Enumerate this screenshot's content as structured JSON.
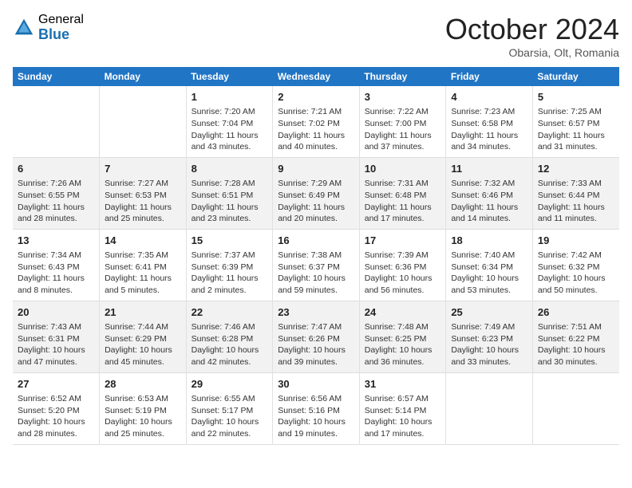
{
  "header": {
    "logo_general": "General",
    "logo_blue": "Blue",
    "month_title": "October 2024",
    "location": "Obarsia, Olt, Romania"
  },
  "days_of_week": [
    "Sunday",
    "Monday",
    "Tuesday",
    "Wednesday",
    "Thursday",
    "Friday",
    "Saturday"
  ],
  "weeks": [
    [
      {
        "day": "",
        "sunrise": "",
        "sunset": "",
        "daylight": ""
      },
      {
        "day": "",
        "sunrise": "",
        "sunset": "",
        "daylight": ""
      },
      {
        "day": "1",
        "sunrise": "Sunrise: 7:20 AM",
        "sunset": "Sunset: 7:04 PM",
        "daylight": "Daylight: 11 hours and 43 minutes."
      },
      {
        "day": "2",
        "sunrise": "Sunrise: 7:21 AM",
        "sunset": "Sunset: 7:02 PM",
        "daylight": "Daylight: 11 hours and 40 minutes."
      },
      {
        "day": "3",
        "sunrise": "Sunrise: 7:22 AM",
        "sunset": "Sunset: 7:00 PM",
        "daylight": "Daylight: 11 hours and 37 minutes."
      },
      {
        "day": "4",
        "sunrise": "Sunrise: 7:23 AM",
        "sunset": "Sunset: 6:58 PM",
        "daylight": "Daylight: 11 hours and 34 minutes."
      },
      {
        "day": "5",
        "sunrise": "Sunrise: 7:25 AM",
        "sunset": "Sunset: 6:57 PM",
        "daylight": "Daylight: 11 hours and 31 minutes."
      }
    ],
    [
      {
        "day": "6",
        "sunrise": "Sunrise: 7:26 AM",
        "sunset": "Sunset: 6:55 PM",
        "daylight": "Daylight: 11 hours and 28 minutes."
      },
      {
        "day": "7",
        "sunrise": "Sunrise: 7:27 AM",
        "sunset": "Sunset: 6:53 PM",
        "daylight": "Daylight: 11 hours and 25 minutes."
      },
      {
        "day": "8",
        "sunrise": "Sunrise: 7:28 AM",
        "sunset": "Sunset: 6:51 PM",
        "daylight": "Daylight: 11 hours and 23 minutes."
      },
      {
        "day": "9",
        "sunrise": "Sunrise: 7:29 AM",
        "sunset": "Sunset: 6:49 PM",
        "daylight": "Daylight: 11 hours and 20 minutes."
      },
      {
        "day": "10",
        "sunrise": "Sunrise: 7:31 AM",
        "sunset": "Sunset: 6:48 PM",
        "daylight": "Daylight: 11 hours and 17 minutes."
      },
      {
        "day": "11",
        "sunrise": "Sunrise: 7:32 AM",
        "sunset": "Sunset: 6:46 PM",
        "daylight": "Daylight: 11 hours and 14 minutes."
      },
      {
        "day": "12",
        "sunrise": "Sunrise: 7:33 AM",
        "sunset": "Sunset: 6:44 PM",
        "daylight": "Daylight: 11 hours and 11 minutes."
      }
    ],
    [
      {
        "day": "13",
        "sunrise": "Sunrise: 7:34 AM",
        "sunset": "Sunset: 6:43 PM",
        "daylight": "Daylight: 11 hours and 8 minutes."
      },
      {
        "day": "14",
        "sunrise": "Sunrise: 7:35 AM",
        "sunset": "Sunset: 6:41 PM",
        "daylight": "Daylight: 11 hours and 5 minutes."
      },
      {
        "day": "15",
        "sunrise": "Sunrise: 7:37 AM",
        "sunset": "Sunset: 6:39 PM",
        "daylight": "Daylight: 11 hours and 2 minutes."
      },
      {
        "day": "16",
        "sunrise": "Sunrise: 7:38 AM",
        "sunset": "Sunset: 6:37 PM",
        "daylight": "Daylight: 10 hours and 59 minutes."
      },
      {
        "day": "17",
        "sunrise": "Sunrise: 7:39 AM",
        "sunset": "Sunset: 6:36 PM",
        "daylight": "Daylight: 10 hours and 56 minutes."
      },
      {
        "day": "18",
        "sunrise": "Sunrise: 7:40 AM",
        "sunset": "Sunset: 6:34 PM",
        "daylight": "Daylight: 10 hours and 53 minutes."
      },
      {
        "day": "19",
        "sunrise": "Sunrise: 7:42 AM",
        "sunset": "Sunset: 6:32 PM",
        "daylight": "Daylight: 10 hours and 50 minutes."
      }
    ],
    [
      {
        "day": "20",
        "sunrise": "Sunrise: 7:43 AM",
        "sunset": "Sunset: 6:31 PM",
        "daylight": "Daylight: 10 hours and 47 minutes."
      },
      {
        "day": "21",
        "sunrise": "Sunrise: 7:44 AM",
        "sunset": "Sunset: 6:29 PM",
        "daylight": "Daylight: 10 hours and 45 minutes."
      },
      {
        "day": "22",
        "sunrise": "Sunrise: 7:46 AM",
        "sunset": "Sunset: 6:28 PM",
        "daylight": "Daylight: 10 hours and 42 minutes."
      },
      {
        "day": "23",
        "sunrise": "Sunrise: 7:47 AM",
        "sunset": "Sunset: 6:26 PM",
        "daylight": "Daylight: 10 hours and 39 minutes."
      },
      {
        "day": "24",
        "sunrise": "Sunrise: 7:48 AM",
        "sunset": "Sunset: 6:25 PM",
        "daylight": "Daylight: 10 hours and 36 minutes."
      },
      {
        "day": "25",
        "sunrise": "Sunrise: 7:49 AM",
        "sunset": "Sunset: 6:23 PM",
        "daylight": "Daylight: 10 hours and 33 minutes."
      },
      {
        "day": "26",
        "sunrise": "Sunrise: 7:51 AM",
        "sunset": "Sunset: 6:22 PM",
        "daylight": "Daylight: 10 hours and 30 minutes."
      }
    ],
    [
      {
        "day": "27",
        "sunrise": "Sunrise: 6:52 AM",
        "sunset": "Sunset: 5:20 PM",
        "daylight": "Daylight: 10 hours and 28 minutes."
      },
      {
        "day": "28",
        "sunrise": "Sunrise: 6:53 AM",
        "sunset": "Sunset: 5:19 PM",
        "daylight": "Daylight: 10 hours and 25 minutes."
      },
      {
        "day": "29",
        "sunrise": "Sunrise: 6:55 AM",
        "sunset": "Sunset: 5:17 PM",
        "daylight": "Daylight: 10 hours and 22 minutes."
      },
      {
        "day": "30",
        "sunrise": "Sunrise: 6:56 AM",
        "sunset": "Sunset: 5:16 PM",
        "daylight": "Daylight: 10 hours and 19 minutes."
      },
      {
        "day": "31",
        "sunrise": "Sunrise: 6:57 AM",
        "sunset": "Sunset: 5:14 PM",
        "daylight": "Daylight: 10 hours and 17 minutes."
      },
      {
        "day": "",
        "sunrise": "",
        "sunset": "",
        "daylight": ""
      },
      {
        "day": "",
        "sunrise": "",
        "sunset": "",
        "daylight": ""
      }
    ]
  ]
}
